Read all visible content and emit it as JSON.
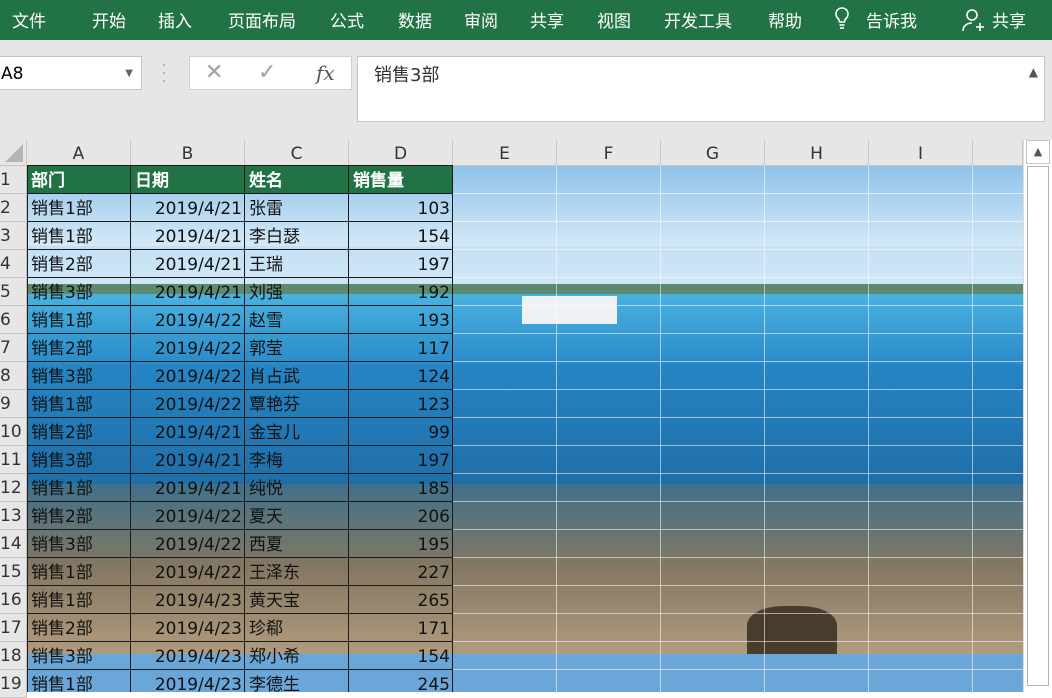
{
  "ribbon": {
    "tabs": [
      "文件",
      "开始",
      "插入",
      "页面布局",
      "公式",
      "数据",
      "审阅",
      "共享",
      "视图",
      "开发工具",
      "帮助"
    ],
    "tell_me": "告诉我",
    "share": "共享"
  },
  "name_box": "A8",
  "formula_bar": {
    "content": "销售3部",
    "fx": "fx",
    "cancel": "✕",
    "enter": "✓"
  },
  "columns": [
    "A",
    "B",
    "C",
    "D",
    "E",
    "F",
    "G",
    "H",
    "I"
  ],
  "rows": [
    "1",
    "2",
    "3",
    "4",
    "5",
    "6",
    "7",
    "8",
    "9",
    "10",
    "11",
    "12",
    "13",
    "14",
    "15",
    "16",
    "17",
    "18",
    "19"
  ],
  "table": {
    "headers": [
      "部门",
      "日期",
      "姓名",
      "销售量"
    ],
    "rows": [
      [
        "销售1部",
        "2019/4/21",
        "张雷",
        "103"
      ],
      [
        "销售1部",
        "2019/4/21",
        "李白瑟",
        "154"
      ],
      [
        "销售2部",
        "2019/4/21",
        "王瑞",
        "197"
      ],
      [
        "销售3部",
        "2019/4/21",
        "刘强",
        "192"
      ],
      [
        "销售1部",
        "2019/4/22",
        "赵雪",
        "193"
      ],
      [
        "销售2部",
        "2019/4/22",
        "郭莹",
        "117"
      ],
      [
        "销售3部",
        "2019/4/22",
        "肖占武",
        "124"
      ],
      [
        "销售1部",
        "2019/4/22",
        "覃艳芬",
        "123"
      ],
      [
        "销售2部",
        "2019/4/21",
        "金宝儿",
        "99"
      ],
      [
        "销售3部",
        "2019/4/21",
        "李梅",
        "197"
      ],
      [
        "销售1部",
        "2019/4/21",
        "纯悦",
        "185"
      ],
      [
        "销售2部",
        "2019/4/22",
        "夏天",
        "206"
      ],
      [
        "销售3部",
        "2019/4/22",
        "西夏",
        "195"
      ],
      [
        "销售1部",
        "2019/4/22",
        "王泽东",
        "227"
      ],
      [
        "销售1部",
        "2019/4/23",
        "黄天宝",
        "265"
      ],
      [
        "销售2部",
        "2019/4/23",
        "珍郗",
        "171"
      ],
      [
        "销售3部",
        "2019/4/23",
        "郑小希",
        "154"
      ],
      [
        "销售1部",
        "2019/4/23",
        "李德生",
        "245"
      ]
    ]
  },
  "colors": {
    "ribbon": "#217346",
    "header_fill": "#217346"
  }
}
